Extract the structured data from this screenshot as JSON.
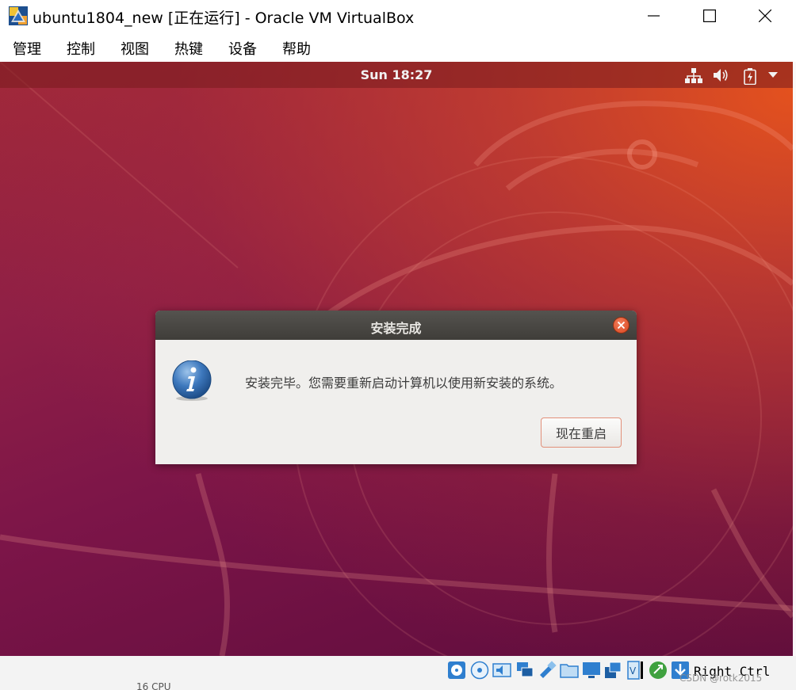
{
  "window": {
    "title": "ubuntu1804_new [正在运行] - Oracle VM VirtualBox",
    "controls": [
      "minimize",
      "maximize",
      "close"
    ]
  },
  "menu": {
    "items": [
      "管理",
      "控制",
      "视图",
      "热键",
      "设备",
      "帮助"
    ]
  },
  "guest": {
    "topbar": {
      "clock": "Sun 18:27",
      "tray_icons": [
        "network-icon",
        "volume-icon",
        "battery-icon",
        "dropdown-arrow-icon"
      ]
    },
    "dialog": {
      "title": "安装完成",
      "message": "安装完毕。您需要重新启动计算机以使用新安装的系统。",
      "button_label": "现在重启",
      "icon": "info-icon"
    }
  },
  "statusbar": {
    "icons": [
      "hard-disk-icon",
      "optical-drive-icon",
      "audio-icon",
      "network-icon",
      "usb-icon",
      "shared-folders-icon",
      "display-icon",
      "recording-icon",
      "cpu-icon",
      "mouse-integration-icon",
      "keyboard-capture-icon"
    ],
    "host_key": "Right Ctrl",
    "underlay_text": "16 CPU",
    "watermark": "CSDN @rotk2015"
  },
  "colors": {
    "ubuntu_orange": "#e95420",
    "aubergine": "#77216f",
    "dialog_header": "#3f3d39",
    "dialog_close": "#d9461f"
  }
}
